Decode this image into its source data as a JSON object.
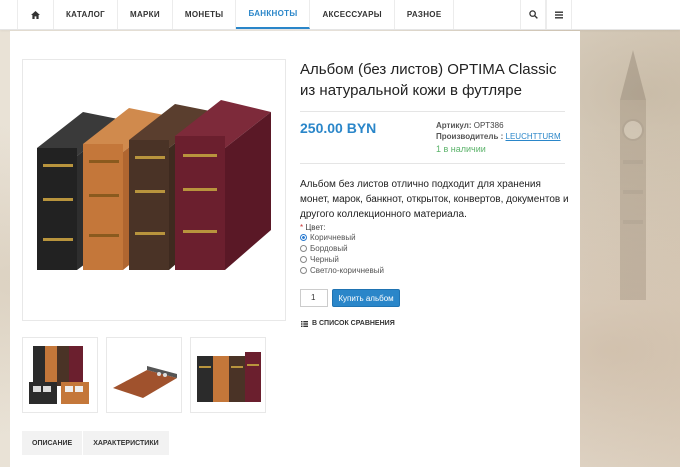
{
  "nav": {
    "items": [
      "КАТАЛОГ",
      "МАРКИ",
      "МОНЕТЫ",
      "БАНКНОТЫ",
      "АКСЕССУАРЫ",
      "РАЗНОЕ"
    ],
    "active_index": 3
  },
  "product": {
    "title": "Альбом (без листов) OPTIMA Classic из натуральной кожи в футляре",
    "price": "250.00 BYN",
    "article_label": "Артикул:",
    "article": "OPT386",
    "manufacturer_label": "Производитель :",
    "manufacturer": "LEUCHTTURM",
    "stock": "1 в наличии",
    "description": "Альбом без листов отлично подходит для хранения монет, марок, банкнот, открыток, конвертов, документов и другого коллекционного материала.",
    "color_required_mark": "*",
    "color_label": "Цвет:",
    "colors": [
      "Коричневый",
      "Бордовый",
      "Черный",
      "Светло-коричневый"
    ],
    "selected_color_index": 0,
    "quantity": "1",
    "buy_label": "Купить альбом",
    "compare_label": "В СПИСОК СРАВНЕНИЯ"
  },
  "tabs": [
    "ОПИСАНИЕ",
    "ХАРАКТЕРИСТИКИ"
  ],
  "colors": {
    "accent": "#2a86c9",
    "stock": "#5bb36a",
    "binder_black": "#2b2b2b",
    "binder_tan": "#c4773a",
    "binder_brown": "#4a3326",
    "binder_burgundy": "#6b1f2e"
  }
}
